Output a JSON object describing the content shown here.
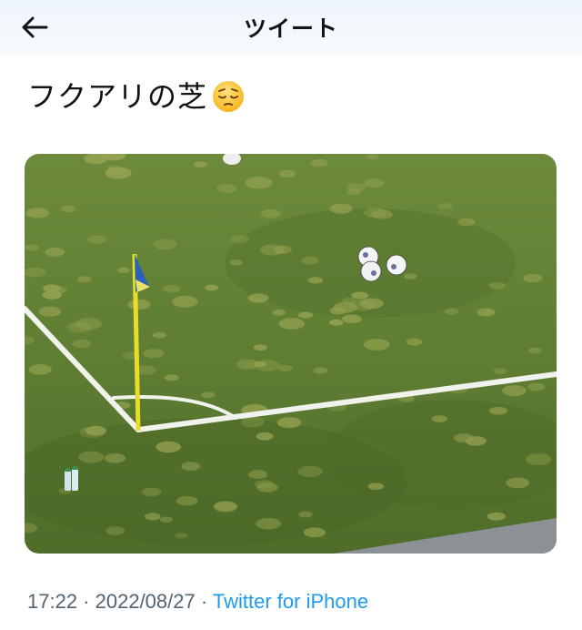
{
  "header": {
    "title": "ツイート",
    "back_icon": "arrow-left-icon"
  },
  "tweet": {
    "text": "フクアリの芝",
    "emoji": "pensive-face-emoji",
    "time": "17:22",
    "separator": " · ",
    "date": "2022/08/27",
    "source": "Twitter for iPhone"
  },
  "colors": {
    "link": "#1d9bf0",
    "meta": "#536471",
    "text": "#0f1419"
  }
}
